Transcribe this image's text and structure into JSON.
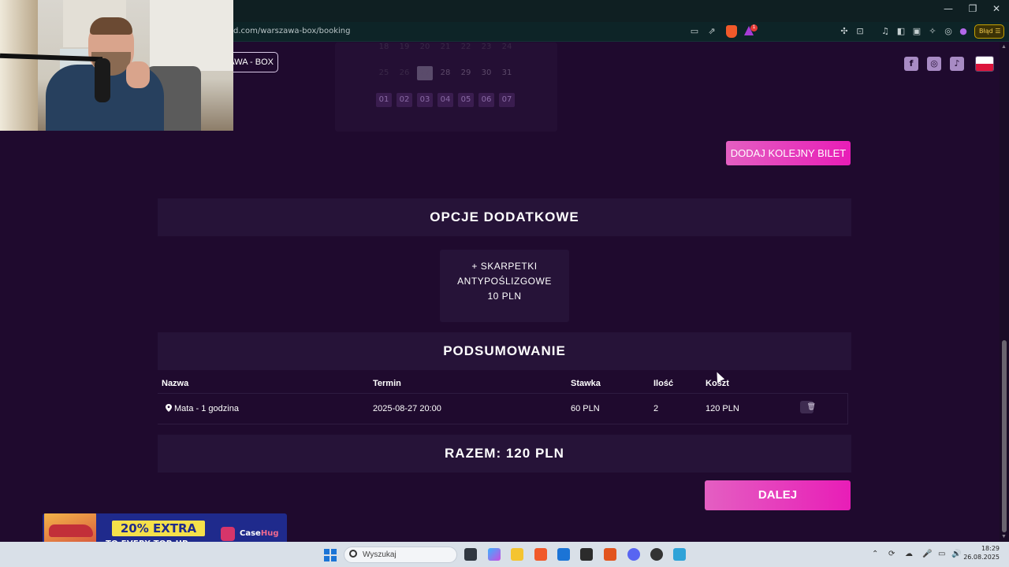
{
  "browser": {
    "url": "d.com/warszawa-box/booking",
    "window_controls": [
      "—",
      "❐",
      "✕"
    ],
    "brave_badge": "1",
    "status_label": "Błąd"
  },
  "header": {
    "logo_text": "AWA - BOX",
    "social_icons": [
      "facebook-icon",
      "instagram-icon",
      "tiktok-icon"
    ],
    "language": "pl"
  },
  "calendar": {
    "row1": [
      "18",
      "19",
      "20",
      "21",
      "22",
      "23",
      "24"
    ],
    "row2": [
      "25",
      "26",
      "27",
      "28",
      "29",
      "30",
      "31"
    ],
    "row3": [
      "01",
      "02",
      "03",
      "04",
      "05",
      "06",
      "07"
    ]
  },
  "add_ticket_label": "DODAJ KOLEJNY BILET",
  "extras": {
    "title": "OPCJE DODATKOWE",
    "item_line1": "+ SKARPETKI",
    "item_line2": "ANTYPOŚLIZGOWE",
    "item_price": "10 PLN"
  },
  "summary": {
    "title": "PODSUMOWANIE",
    "columns": [
      "Nazwa",
      "Termin",
      "Stawka",
      "Ilość",
      "Koszt"
    ],
    "rows": [
      {
        "name": "Mata - 1 godzina",
        "date": "2025-08-27 20:00",
        "rate": "60 PLN",
        "qty": "2",
        "cost": "120 PLN"
      }
    ],
    "total": "RAZEM: 120 PLN"
  },
  "next_label": "DALEJ",
  "ad": {
    "extra": "20% EXTRA",
    "topup": "TO EVERY TOP-UP",
    "brand_a": "Case",
    "brand_b": "Hug"
  },
  "taskbar": {
    "search_placeholder": "Wyszukaj",
    "time": "18:29",
    "date": "26.08.2025",
    "colors": {
      "accent": "#e81db7",
      "page_bg": "#1f0a2e",
      "taskbar": "#d9e0e8"
    }
  }
}
